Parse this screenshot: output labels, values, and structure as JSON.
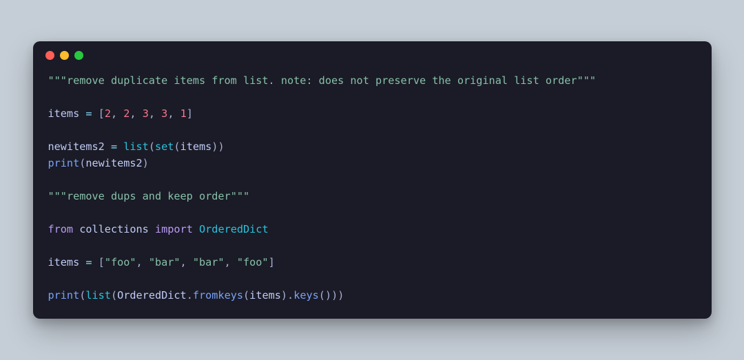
{
  "window": {
    "dots": [
      "red",
      "yellow",
      "green"
    ]
  },
  "code": {
    "docstring1_open": "\"\"\"",
    "docstring1_text": "remove duplicate items from list. note: does not preserve the original list order",
    "docstring1_close": "\"\"\"",
    "items1_name": "items",
    "eq": " = ",
    "lbracket": "[",
    "rbracket": "]",
    "comma": ", ",
    "items1_vals": [
      "2",
      "2",
      "3",
      "3",
      "1"
    ],
    "newitems_name": "newitems2",
    "list_fn": "list",
    "set_fn": "set",
    "lparen": "(",
    "rparen": ")",
    "items_ref": "items",
    "print_fn": "print",
    "newitems_ref": "newitems2",
    "docstring2_open": "\"\"\"",
    "docstring2_text": "remove dups and keep order",
    "docstring2_close": "\"\"\"",
    "kw_from": "from",
    "module": "collections",
    "kw_import": "import",
    "ordereddict": "OrderedDict",
    "items2_name": "items",
    "items2_vals": [
      "\"foo\"",
      "\"bar\"",
      "\"bar\"",
      "\"foo\""
    ],
    "dot": ".",
    "fromkeys_fn": "fromkeys",
    "keys_fn": "keys"
  }
}
